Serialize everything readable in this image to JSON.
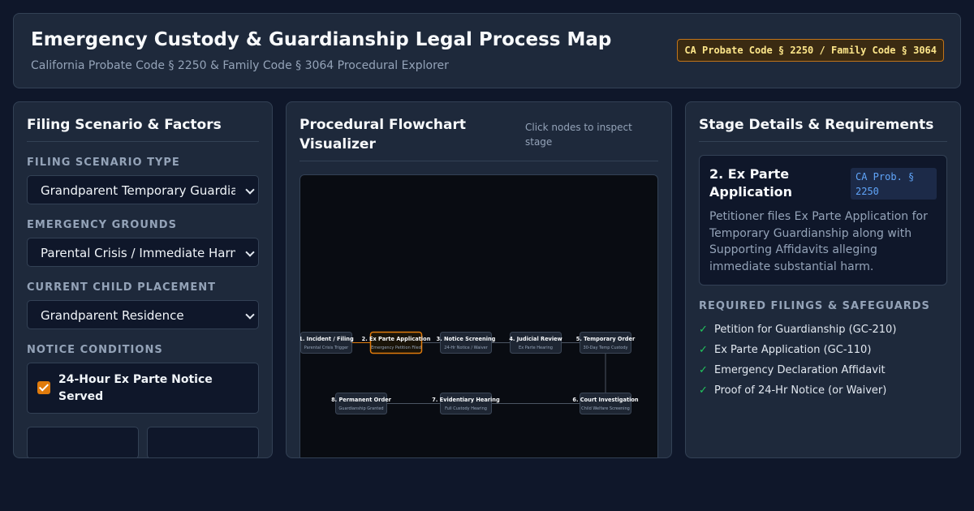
{
  "header": {
    "title": "Emergency Custody & Guardianship Legal Process Map",
    "subtitle": "California Probate Code § 2250 & Family Code § 3064 Procedural Explorer",
    "badge": "CA Probate Code § 2250 / Family Code § 3064"
  },
  "filing": {
    "title": "Filing Scenario & Factors",
    "scenario_label": "FILING SCENARIO TYPE",
    "scenario_value": "Grandparent Temporary Guardianship",
    "grounds_label": "EMERGENCY GROUNDS",
    "grounds_value": "Parental Crisis / Immediate Harm Risk",
    "placement_label": "CURRENT CHILD PLACEMENT",
    "placement_value": "Grandparent Residence",
    "notice_label": "NOTICE CONDITIONS",
    "notice_checkbox_label": "24-Hour Ex Parte Notice Served",
    "notice_checked": true
  },
  "flowchart": {
    "title": "Procedural Flowchart Visualizer",
    "hint": "Click nodes to inspect stage",
    "active_node": 2,
    "nodes": [
      {
        "title": "1. Incident / Filing",
        "sub": "Parental Crisis Trigger"
      },
      {
        "title": "2. Ex Parte Application",
        "sub": "Emergency Petition Filed"
      },
      {
        "title": "3. Notice Screening",
        "sub": "24-Hr Notice / Waiver"
      },
      {
        "title": "4. Judicial Review",
        "sub": "Ex Parte Hearing"
      },
      {
        "title": "5. Temporary Order",
        "sub": "30-Day Temp Custody"
      },
      {
        "title": "6. Court Investigation",
        "sub": "Child Welfare Screening"
      },
      {
        "title": "7. Evidentiary Hearing",
        "sub": "Full Custody Hearing"
      },
      {
        "title": "8. Permanent Order",
        "sub": "Guardianship Granted"
      }
    ],
    "colors": {
      "active": "#e07b0c",
      "node_border": "#3b4656",
      "edge": "#4b5563"
    }
  },
  "details": {
    "title": "Stage Details & Requirements",
    "stage_name": "2. Ex Parte Application",
    "stage_code": "CA Prob. § 2250",
    "stage_description": "Petitioner files Ex Parte Application for Temporary Guardianship along with Supporting Affidavits alleging immediate substantial harm.",
    "requirements_label": "REQUIRED FILINGS & SAFEGUARDS",
    "requirements": [
      "Petition for Guardianship (GC-210)",
      "Ex Parte Application (GC-110)",
      "Emergency Declaration Affidavit",
      "Proof of 24-Hr Notice (or Waiver)"
    ]
  }
}
